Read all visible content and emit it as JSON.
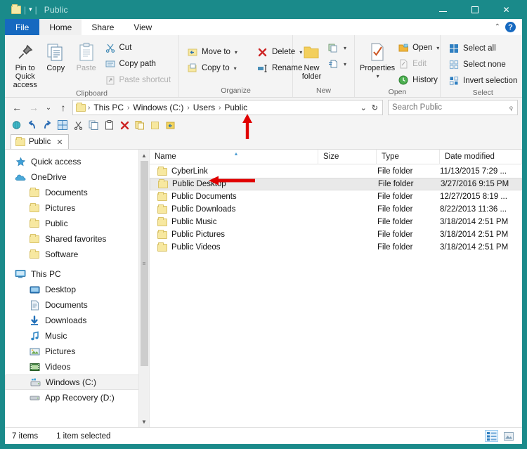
{
  "window": {
    "title": "Public",
    "controls": {
      "minimize": "–",
      "maximize": "□",
      "close": "✕"
    },
    "accent_color": "#1a8a8a"
  },
  "quick_access_toolbar": {
    "folder_icon": "folder-icon",
    "customize_caret": "▾"
  },
  "ribbon": {
    "tabs": [
      {
        "label": "File",
        "active": false,
        "style": "file"
      },
      {
        "label": "Home",
        "active": true,
        "style": "normal"
      },
      {
        "label": "Share",
        "active": false,
        "style": "normal"
      },
      {
        "label": "View",
        "active": false,
        "style": "normal"
      }
    ],
    "collapse_caret": "⌃",
    "help_label": "?",
    "groups": [
      {
        "name": "Clipboard",
        "label": "Clipboard",
        "big_buttons": [
          {
            "label": "Pin to Quick\naccess",
            "line1": "Pin to Quick",
            "line2": "access",
            "icon": "pin-icon",
            "enabled": true
          },
          {
            "label": "Copy",
            "line1": "Copy",
            "line2": "",
            "icon": "copy-icon",
            "enabled": true
          },
          {
            "label": "Paste",
            "line1": "Paste",
            "line2": "",
            "icon": "paste-icon",
            "enabled": false
          }
        ],
        "small_buttons": [
          {
            "label": "Cut",
            "icon": "scissors-icon",
            "enabled": true,
            "caret": false
          },
          {
            "label": "Copy path",
            "icon": "copy-path-icon",
            "enabled": true,
            "caret": false
          },
          {
            "label": "Paste shortcut",
            "icon": "paste-shortcut-icon",
            "enabled": false,
            "caret": false
          }
        ]
      },
      {
        "name": "Organize",
        "label": "Organize",
        "small_buttons": [
          {
            "label": "Move to",
            "icon": "move-to-icon",
            "enabled": true,
            "caret": true
          },
          {
            "label": "Copy to",
            "icon": "copy-to-icon",
            "enabled": true,
            "caret": true
          },
          {
            "label": "Delete",
            "icon": "delete-icon",
            "enabled": true,
            "caret": true
          },
          {
            "label": "Rename",
            "icon": "rename-icon",
            "enabled": true,
            "caret": false
          }
        ]
      },
      {
        "name": "New",
        "label": "New",
        "big_buttons": [
          {
            "line1": "New",
            "line2": "folder",
            "icon": "new-folder-icon",
            "enabled": true
          }
        ],
        "small_buttons": [
          {
            "label": "",
            "icon": "new-item-icon",
            "enabled": true,
            "caret": true
          },
          {
            "label": "",
            "icon": "easy-access-icon",
            "enabled": true,
            "caret": true
          }
        ]
      },
      {
        "name": "Open",
        "label": "Open",
        "big_buttons": [
          {
            "line1": "Properties",
            "line2": "▾",
            "icon": "properties-icon",
            "enabled": true
          }
        ],
        "small_buttons": [
          {
            "label": "Open",
            "icon": "open-icon",
            "enabled": true,
            "caret": true
          },
          {
            "label": "Edit",
            "icon": "edit-icon",
            "enabled": false,
            "caret": false
          },
          {
            "label": "History",
            "icon": "history-icon",
            "enabled": true,
            "caret": false
          }
        ]
      },
      {
        "name": "Select",
        "label": "Select",
        "small_buttons": [
          {
            "label": "Select all",
            "icon": "select-all-icon",
            "enabled": true,
            "caret": false
          },
          {
            "label": "Select none",
            "icon": "select-none-icon",
            "enabled": true,
            "caret": false
          },
          {
            "label": "Invert selection",
            "icon": "invert-selection-icon",
            "enabled": true,
            "caret": false
          }
        ]
      }
    ]
  },
  "address_bar": {
    "back": "←",
    "forward": "→",
    "recent_caret": "⌄",
    "up": "↑",
    "breadcrumbs": [
      "This PC",
      "Windows (C:)",
      "Users",
      "Public"
    ],
    "separator": "›",
    "dropdown_caret": "⌄",
    "refresh": "↻"
  },
  "search": {
    "placeholder": "Search Public",
    "value": "",
    "icon": "search-icon"
  },
  "addon_toolbar": {
    "icons": [
      "globe-icon",
      "undo-icon",
      "redo-icon",
      "grid-icon",
      "cut-icon",
      "copy-icon",
      "paste-icon",
      "delete-x-icon",
      "duplicate-icon",
      "new-folder-icon",
      "move-back-icon"
    ]
  },
  "tab_strip": {
    "tabs": [
      {
        "label": "Public",
        "icon": "folder-icon",
        "close": "✕",
        "active": true
      }
    ]
  },
  "nav_pane": {
    "items": [
      {
        "label": "Quick access",
        "icon": "star-pin-icon",
        "indent": 0,
        "selected": false
      },
      {
        "label": "OneDrive",
        "icon": "onedrive-cloud-icon",
        "indent": 0,
        "selected": false
      },
      {
        "label": "Documents",
        "icon": "folder-icon",
        "indent": 1,
        "selected": false
      },
      {
        "label": "Pictures",
        "icon": "folder-icon",
        "indent": 1,
        "selected": false
      },
      {
        "label": "Public",
        "icon": "folder-icon",
        "indent": 1,
        "selected": false
      },
      {
        "label": "Shared favorites",
        "icon": "folder-icon",
        "indent": 1,
        "selected": false
      },
      {
        "label": "Software",
        "icon": "folder-icon",
        "indent": 1,
        "selected": false
      },
      {
        "label": "This PC",
        "icon": "this-pc-icon",
        "indent": 0,
        "selected": false
      },
      {
        "label": "Desktop",
        "icon": "desktop-icon",
        "indent": 1,
        "selected": false
      },
      {
        "label": "Documents",
        "icon": "documents-icon",
        "indent": 1,
        "selected": false
      },
      {
        "label": "Downloads",
        "icon": "downloads-icon",
        "indent": 1,
        "selected": false
      },
      {
        "label": "Music",
        "icon": "music-icon",
        "indent": 1,
        "selected": false
      },
      {
        "label": "Pictures",
        "icon": "pictures-icon",
        "indent": 1,
        "selected": false
      },
      {
        "label": "Videos",
        "icon": "videos-icon",
        "indent": 1,
        "selected": false
      },
      {
        "label": "Windows (C:)",
        "icon": "drive-windows-icon",
        "indent": 1,
        "selected": true
      },
      {
        "label": "App Recovery (D:)",
        "icon": "drive-icon",
        "indent": 1,
        "selected": false
      }
    ]
  },
  "file_list": {
    "columns": [
      {
        "key": "name",
        "label": "Name",
        "sorted": true,
        "sort_dir": "asc"
      },
      {
        "key": "size",
        "label": "Size",
        "sorted": false
      },
      {
        "key": "type",
        "label": "Type",
        "sorted": false
      },
      {
        "key": "date",
        "label": "Date modified",
        "sorted": false
      }
    ],
    "rows": [
      {
        "name": "CyberLink",
        "size": "",
        "type": "File folder",
        "date": "11/13/2015 7:29 ...",
        "selected": false,
        "icon": "folder-icon"
      },
      {
        "name": "Public Desktop",
        "size": "",
        "type": "File folder",
        "date": "3/27/2016 9:15 PM",
        "selected": true,
        "icon": "folder-icon"
      },
      {
        "name": "Public Documents",
        "size": "",
        "type": "File folder",
        "date": "12/27/2015 8:19 ...",
        "selected": false,
        "icon": "folder-icon"
      },
      {
        "name": "Public Downloads",
        "size": "",
        "type": "File folder",
        "date": "8/22/2013 11:36 ...",
        "selected": false,
        "icon": "folder-icon"
      },
      {
        "name": "Public Music",
        "size": "",
        "type": "File folder",
        "date": "3/18/2014 2:51 PM",
        "selected": false,
        "icon": "folder-icon"
      },
      {
        "name": "Public Pictures",
        "size": "",
        "type": "File folder",
        "date": "3/18/2014 2:51 PM",
        "selected": false,
        "icon": "folder-icon"
      },
      {
        "name": "Public Videos",
        "size": "",
        "type": "File folder",
        "date": "3/18/2014 2:51 PM",
        "selected": false,
        "icon": "folder-icon"
      }
    ]
  },
  "status_bar": {
    "item_count": "7 items",
    "selection": "1 item selected",
    "view_buttons": [
      {
        "name": "details-view",
        "active": true
      },
      {
        "name": "large-icons-view",
        "active": false
      }
    ]
  },
  "annotations": [
    {
      "name": "arrow-pointing-to-public-breadcrumb",
      "direction": "up",
      "color": "#e00000"
    },
    {
      "name": "arrow-pointing-to-public-desktop-row",
      "direction": "left",
      "color": "#e00000"
    }
  ]
}
